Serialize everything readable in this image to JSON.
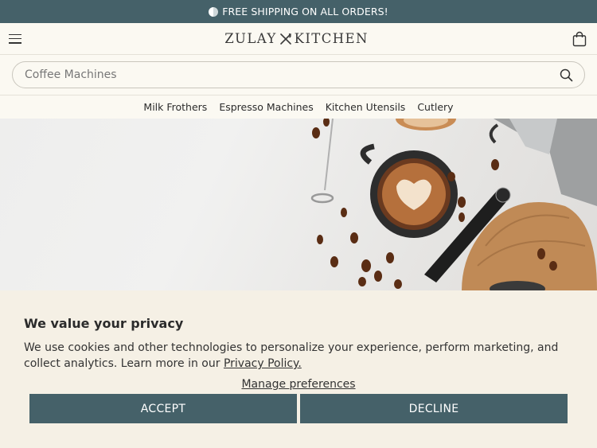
{
  "promo": {
    "text": "FREE SHIPPING ON ALL ORDERS!",
    "icon": "half-circle-icon"
  },
  "header": {
    "logo_left": "ZULAY",
    "logo_right": "KITCHEN",
    "menu_icon": "hamburger-icon",
    "cart_icon": "shopping-bag-icon"
  },
  "search": {
    "placeholder": "Coffee Machines",
    "icon": "search-icon"
  },
  "categories": [
    "Milk Frothers",
    "Espresso Machines",
    "Kitchen Utensils",
    "Cutlery"
  ],
  "hero": {
    "alt": ""
  },
  "cookie": {
    "title": "We value your privacy",
    "body": "We use cookies and other technologies to personalize your experience, perform marketing, and collect analytics. Learn more in our",
    "policy_link": "Privacy Policy.",
    "manage_link": "Manage preferences",
    "accept": "ACCEPT",
    "decline": "DECLINE"
  },
  "colors": {
    "brand": "#456169",
    "background": "#fbf9f2",
    "banner_bg": "#f5f0e5"
  }
}
